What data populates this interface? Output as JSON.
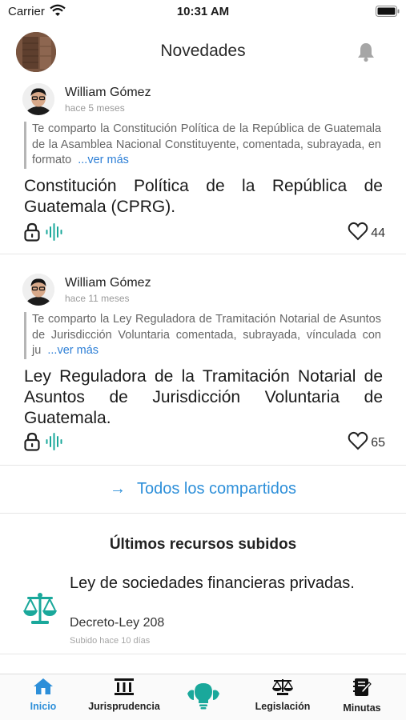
{
  "status_bar": {
    "carrier": "Carrier",
    "time": "10:31 AM"
  },
  "header": {
    "title": "Novedades"
  },
  "posts": [
    {
      "author": "William Gómez",
      "time": "hace 5 meses",
      "excerpt": "Te comparto la Constitución Política de la República de Guatemala de la Asamblea Nacional Constituyente, comentada, subrayada, en formato",
      "more": "...ver más",
      "title": "Constitución Política de la República de Guatemala (CPRG).",
      "likes": "44"
    },
    {
      "author": "William Gómez",
      "time": "hace 11 meses",
      "excerpt": "Te comparto la Ley Reguladora de Tramitación Notarial de Asuntos de Jurisdicción Voluntaria comentada, subrayada, vínculada con ju",
      "more": "...ver más",
      "title": "Ley Reguladora de la Tramitación Notarial de Asuntos de Jurisdicción Voluntaria de Guatemala.",
      "likes": "65"
    }
  ],
  "all_shared": {
    "arrow": "→",
    "label": "Todos los compartidos"
  },
  "recent": {
    "heading": "Últimos recursos subidos",
    "items": [
      {
        "title": "Ley de sociedades financieras privadas.",
        "subtitle": "Decreto-Ley 208",
        "date": "Subido hace 10 días"
      }
    ]
  },
  "tabs": [
    {
      "label": "Inicio",
      "icon": "home-icon",
      "active": true
    },
    {
      "label": "Jurisprudencia",
      "icon": "columns-icon",
      "active": false
    },
    {
      "label": "",
      "icon": "lightbulb-icon",
      "active": false
    },
    {
      "label": "Legislación",
      "icon": "scales-icon",
      "active": false
    },
    {
      "label": "Minutas",
      "icon": "notebook-icon",
      "active": false
    }
  ],
  "colors": {
    "accent": "#2d8fd9",
    "teal": "#1aa89b",
    "link": "#2d7fd6"
  }
}
